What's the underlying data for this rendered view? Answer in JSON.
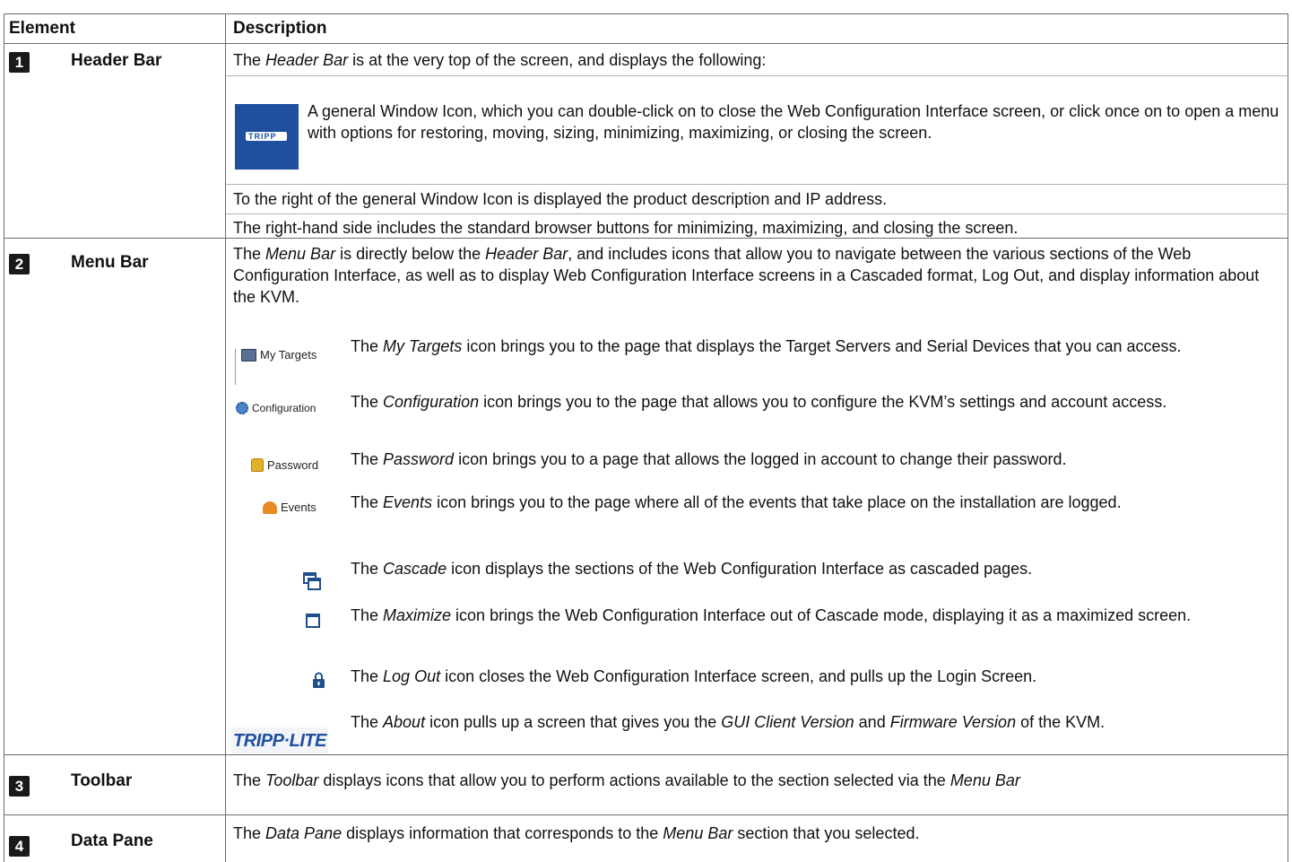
{
  "table": {
    "headers": {
      "element": "Element",
      "description": "Description"
    },
    "rows": [
      {
        "num": "1",
        "name": "Header Bar",
        "p1_pre": "The ",
        "p1_em": "Header Bar",
        "p1_post": " is at the very top of the screen, and displays the following:",
        "window_icon_logo": "TRIPP",
        "window_icon_text": "A general Window Icon, which you can double-click on to close the Web Configuration Interface screen, or click once on to open a menu with options for  restoring, moving, sizing, minimizing, maximizing, or closing the screen.",
        "p2": "To the right of the general Window Icon is displayed the product description and IP address.",
        "p3": "The right-hand side includes the standard browser buttons for minimizing, maximizing, and closing the screen."
      },
      {
        "num": "2",
        "name": "Menu Bar",
        "intro_pre": "The ",
        "intro_em1": "Menu Bar",
        "intro_mid": " is directly below the ",
        "intro_em2": "Header Bar",
        "intro_post": ", and includes icons that allow you to navigate between the various sections of the Web Configuration Interface, as well as to display Web Configuration Interface screens in a Cascaded format, Log Out, and display information about the KVM.",
        "items": [
          {
            "icon_label": "My Targets",
            "icon": "monitor-icon",
            "pre": "The ",
            "em": "My Targets",
            "post": " icon brings you to the page that displays the Target Servers and Serial Devices that you can access."
          },
          {
            "icon_label": "Configuration",
            "icon": "gear-icon",
            "pre": "The ",
            "em": "Configuration",
            "post": " icon brings you to the page that allows you to configure the KVM’s settings and account access."
          },
          {
            "icon_label": "Password",
            "icon": "padlock-icon",
            "pre": "The ",
            "em": "Password",
            "post": " icon brings you to a page that allows the logged in account to change their password."
          },
          {
            "icon_label": "Events",
            "icon": "bell-icon",
            "pre": "The ",
            "em": "Events",
            "post": " icon brings you to the page where all of the events that take place on the installation are logged."
          },
          {
            "icon": "cascade-icon",
            "pre": "The ",
            "em": "Cascade",
            "post": " icon displays the sections of the Web Configuration Interface as cascaded pages."
          },
          {
            "icon": "maximize-icon",
            "pre": "The ",
            "em": "Maximize",
            "post": " icon brings the Web Configuration Interface out of Cascade mode, displaying it as a maximized screen."
          },
          {
            "icon": "lock-icon",
            "pre": "The ",
            "em": "Log Out",
            "post": " icon closes the Web Configuration Interface screen, and pulls up the Login Screen."
          },
          {
            "icon": "tripp-lite-logo",
            "logo_text": "TRIPP·LITE",
            "pre": "The ",
            "em": "About",
            "mid": " icon pulls up a screen that gives you the ",
            "em2": "GUI Client Version",
            "mid2": " and ",
            "em3": "Firmware Version",
            "post": " of the KVM."
          }
        ]
      },
      {
        "num": "3",
        "name": "Toolbar",
        "pre": "The ",
        "em": "Toolbar",
        "mid": " displays icons that allow you to perform actions available to the section selected via the ",
        "em2": "Menu Bar"
      },
      {
        "num": "4",
        "name": "Data Pane",
        "pre": "The ",
        "em": "Data Pane",
        "mid": " displays information that corresponds to the ",
        "em2": "Menu Bar",
        "post": " section that you selected."
      }
    ]
  },
  "colors": {
    "badge": "#1a1a1a",
    "rule": "#6b6b6b",
    "subrule": "#b3b3b3",
    "brand_blue": "#1f4f9d"
  }
}
